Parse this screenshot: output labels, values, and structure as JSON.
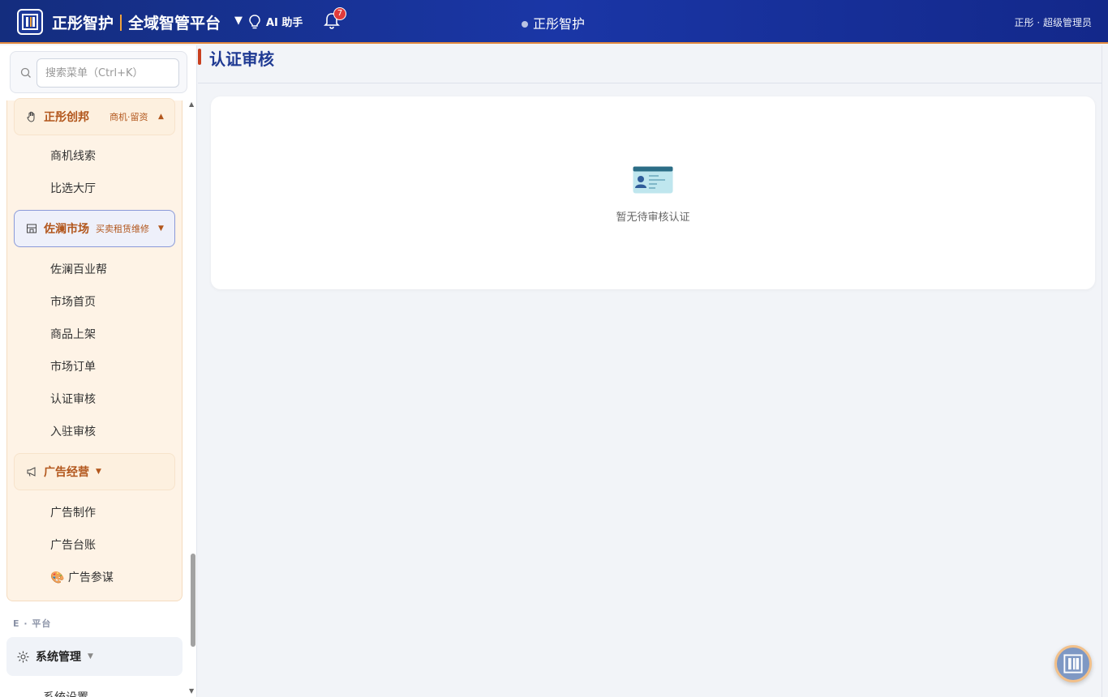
{
  "header": {
    "brand_name": "正彤智护",
    "platform_name": "全域智管平台",
    "ai_label": "AI 助手",
    "notification_count": "7",
    "center_title": "正彤智护",
    "user_label": "正彤 · 超级管理员"
  },
  "sidebar": {
    "search_placeholder": "搜索菜单（Ctrl+K）",
    "groups": [
      {
        "title": "正彤创邦",
        "subtitle": "商机·留资",
        "items": [
          "商机线索",
          "比选大厅"
        ]
      },
      {
        "title": "佐澜市场",
        "subtitle": "买卖租赁维修",
        "items": [
          "佐澜百业帮",
          "市场首页",
          "商品上架",
          "市场订单",
          "认证审核",
          "入驻审核"
        ]
      },
      {
        "title": "广告经营",
        "subtitle": "",
        "items": [
          "广告制作",
          "广告台账",
          "🎨 广告参谋"
        ]
      }
    ],
    "section_label": "E · 平台",
    "system_group": {
      "title": "系统管理",
      "first_item": "系统设置"
    }
  },
  "main": {
    "page_title": "认证审核",
    "empty_text": "暂无待审核认证"
  },
  "colors": {
    "header_bg": "#1a36a6",
    "accent_orange": "#b2561c",
    "title_blue": "#1f3a93"
  }
}
